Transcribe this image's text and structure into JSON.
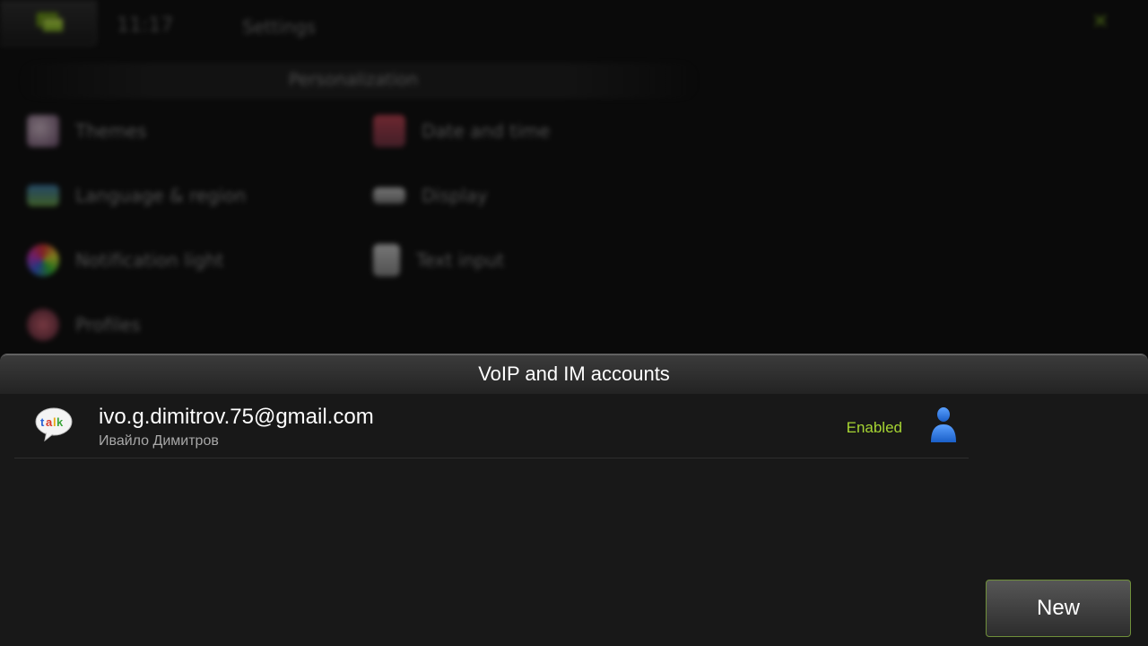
{
  "status_bar": {
    "time": "11:17",
    "title": "Settings"
  },
  "background": {
    "section_title": "Personalization",
    "items": [
      {
        "label": "Themes",
        "icon": "themes-icon"
      },
      {
        "label": "Date and time",
        "icon": "calendar-clock-icon"
      },
      {
        "label": "Language & region",
        "icon": "flag-icon"
      },
      {
        "label": "Display",
        "icon": "display-icon"
      },
      {
        "label": "Notification light",
        "icon": "rgb-light-icon"
      },
      {
        "label": "Text input",
        "icon": "keyboard-icon"
      },
      {
        "label": "Profiles",
        "icon": "profiles-icon"
      }
    ]
  },
  "dialog": {
    "title": "VoIP and IM accounts",
    "accounts": [
      {
        "email": "ivo.g.dimitrov.75@gmail.com",
        "display_name": "Ивайло Димитров",
        "status": "Enabled",
        "service_icon": "google-talk-icon",
        "presence_icon": "person-icon"
      }
    ],
    "new_button_label": "New"
  },
  "colors": {
    "accent_green": "#a6d433",
    "presence_blue": "#2f78e0",
    "dialog_bg": "#181818"
  }
}
